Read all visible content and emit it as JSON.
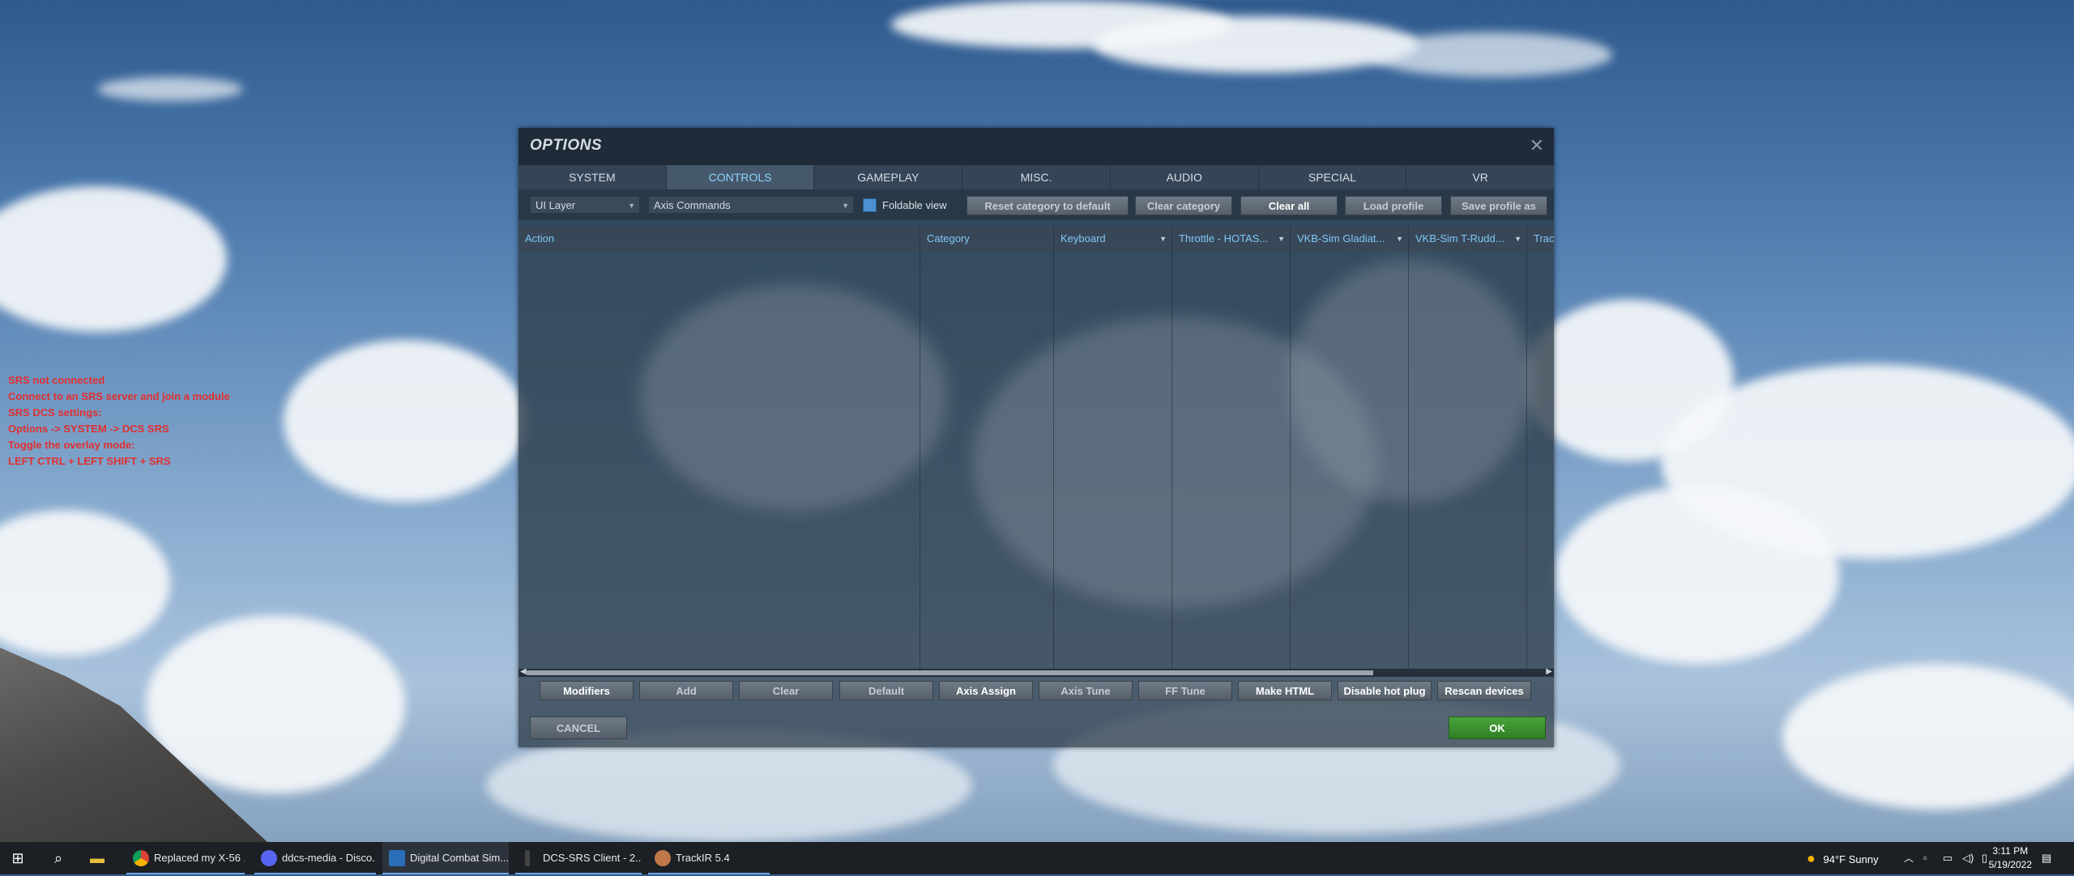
{
  "overlay": {
    "lines": [
      "SRS not connected",
      "Connect to an SRS server and join a module",
      "SRS DCS settings:",
      "Options -> SYSTEM -> DCS SRS",
      "Toggle the overlay mode:",
      "LEFT CTRL + LEFT SHIFT + SRS"
    ]
  },
  "dialog": {
    "title": "OPTIONS",
    "close_icon": "close-icon",
    "tabs": [
      "SYSTEM",
      "CONTROLS",
      "GAMEPLAY",
      "MISC.",
      "AUDIO",
      "SPECIAL",
      "VR"
    ],
    "active_tab": "CONTROLS",
    "toolbar": {
      "layer_select": "UI Layer",
      "commands_select": "Axis Commands",
      "foldable_view_label": "Foldable view",
      "foldable_view_checked": true,
      "reset_category": "Reset category to default",
      "clear_category": "Clear category",
      "clear_all": "Clear all",
      "load_profile": "Load profile",
      "save_profile": "Save profile as"
    },
    "columns": [
      "Action",
      "Category",
      "Keyboard",
      "Throttle - HOTAS...",
      "VKB-Sim Gladiat...",
      "VKB-Sim T-Rudd...",
      "Trac"
    ],
    "rows": [],
    "bottom_buttons": {
      "modifiers": "Modifiers",
      "add": "Add",
      "clear": "Clear",
      "default": "Default",
      "axis_assign": "Axis Assign",
      "axis_tune": "Axis Tune",
      "ff_tune": "FF Tune",
      "make_html": "Make HTML",
      "disable_hot_plug": "Disable hot plug",
      "rescan_devices": "Rescan devices"
    },
    "cancel": "CANCEL",
    "ok": "OK"
  },
  "taskbar": {
    "apps": [
      {
        "label": "Replaced my X-56 ...",
        "icon": "chrome-icon"
      },
      {
        "label": "ddcs-media - Disco...",
        "icon": "discord-icon"
      },
      {
        "label": "Digital Combat Sim...",
        "icon": "dcs-icon"
      },
      {
        "label": "DCS-SRS Client - 2....",
        "icon": "srs-icon"
      },
      {
        "label": "TrackIR 5.4",
        "icon": "trackir-icon"
      }
    ],
    "weather": "94°F  Sunny",
    "time": "3:11 PM",
    "date": "5/19/2022"
  },
  "colors": {
    "accent_tab": "#8fd3ff",
    "ok_green": "#3a9a2e",
    "warning_text": "#e03030"
  }
}
